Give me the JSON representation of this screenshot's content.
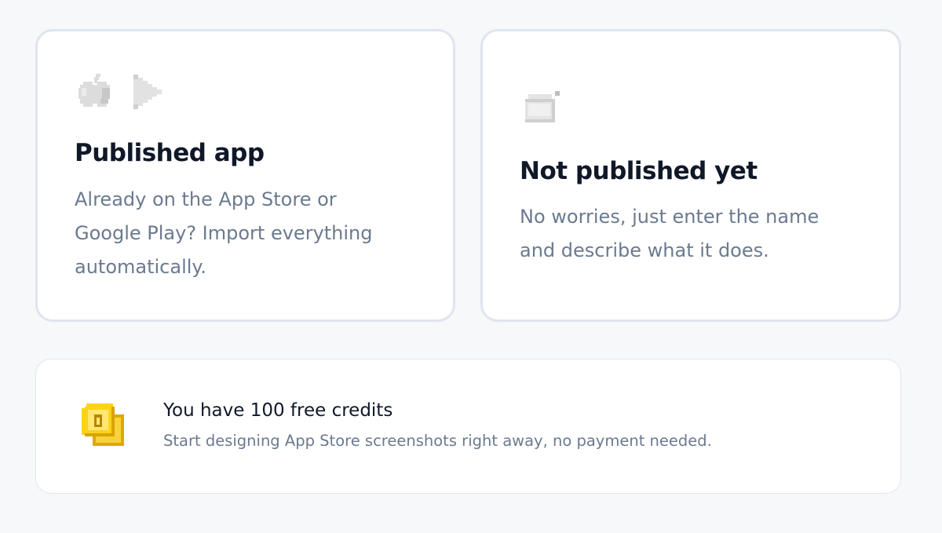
{
  "published_card": {
    "title": "Published app",
    "description": "Already on the App Store or Google Play? Import everything automatically.",
    "icons": [
      "apple-icon",
      "google-play-icon"
    ]
  },
  "unpublished_card": {
    "title": "Not published yet",
    "description": "No worries, just enter the name and describe what it does.",
    "icons": [
      "blank-card-icon"
    ]
  },
  "credits_banner": {
    "title": "You have 100 free credits",
    "description": "Start designing App Store screenshots right away, no payment needed.",
    "icon": "coin-icon"
  },
  "colors": {
    "background": "#f7f8fa",
    "card_border": "#dfe5ee",
    "title_text": "#101828",
    "body_text": "#6b7a8f",
    "coin_gold": "#f5c400"
  }
}
